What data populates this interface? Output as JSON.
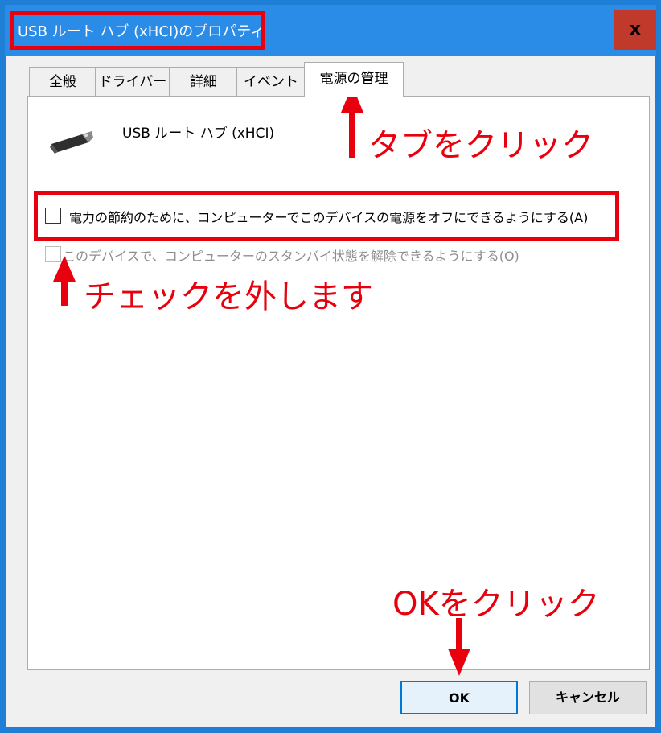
{
  "window": {
    "title": "USB ルート ハブ (xHCI)のプロパティ",
    "close_label": "x"
  },
  "tabs": [
    {
      "label": "全般"
    },
    {
      "label": "ドライバー"
    },
    {
      "label": "詳細"
    },
    {
      "label": "イベント"
    },
    {
      "label": "電源の管理",
      "active": true
    }
  ],
  "device": {
    "icon": "usb-plug-icon",
    "name": "USB ルート ハブ (xHCI)"
  },
  "options": [
    {
      "label": "電力の節約のために、コンピューターでこのデバイスの電源をオフにできるようにする(A)",
      "checked": false,
      "enabled": true
    },
    {
      "label": "このデバイスで、コンピューターのスタンバイ状態を解除できるようにする(O)",
      "checked": false,
      "enabled": false
    }
  ],
  "annotations": {
    "tab_hint": "タブをクリック",
    "check_hint": "チェックを外します",
    "ok_hint": "OKをクリック"
  },
  "buttons": {
    "ok": "OK",
    "cancel": "キャンセル"
  },
  "colors": {
    "annotation": "#e8000e",
    "titlebar": "#2b8ce8"
  }
}
